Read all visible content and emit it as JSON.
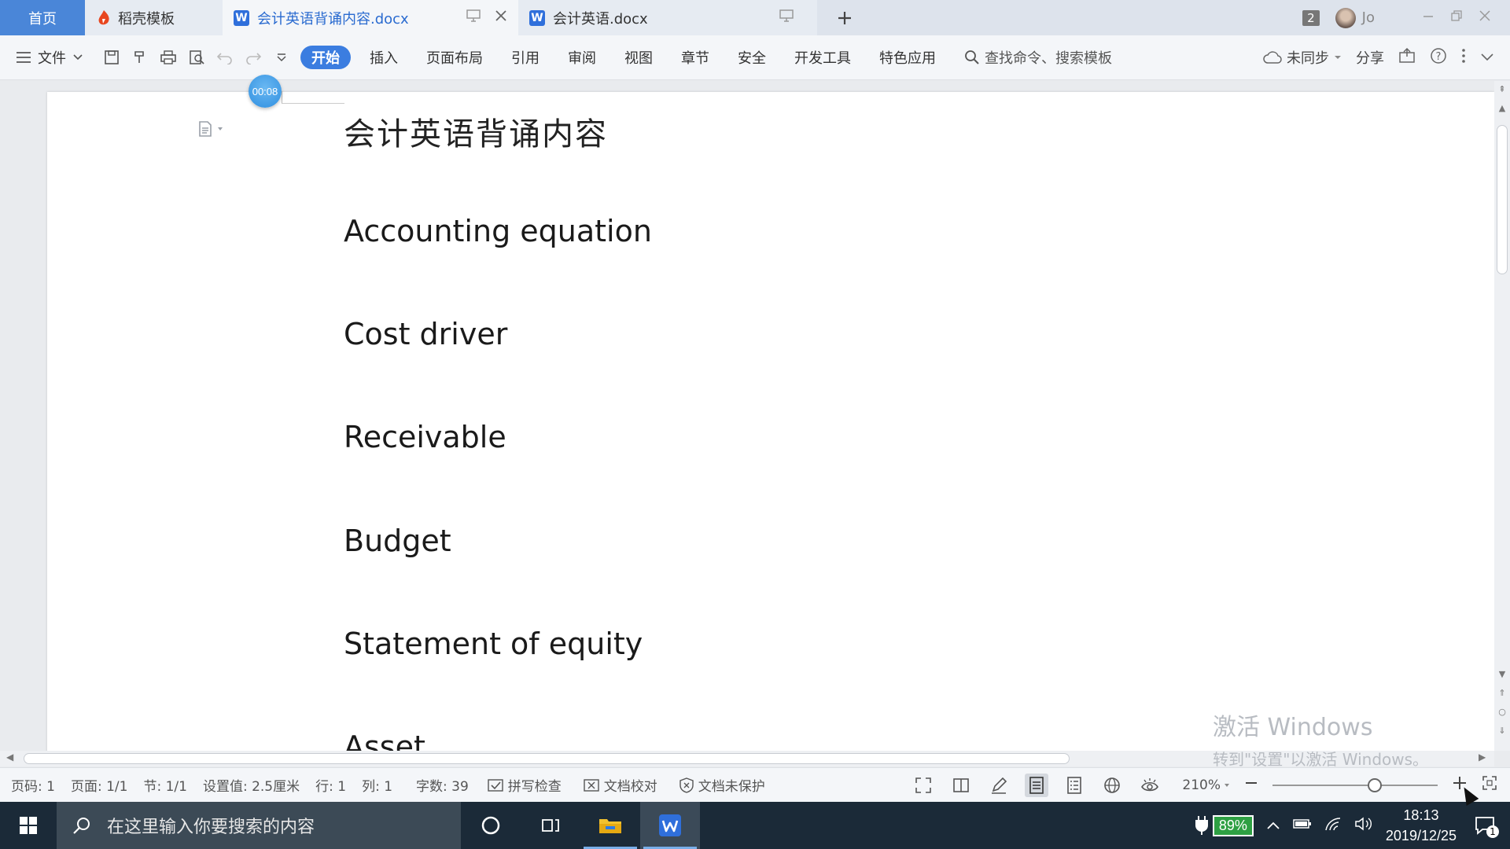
{
  "tabs": {
    "home": "首页",
    "docer": "稻壳模板",
    "active_doc": "会计英语背诵内容.docx",
    "second_doc": "会计英语.docx",
    "window_count": "2",
    "user": "Jo"
  },
  "toolbar": {
    "file_menu": "文件",
    "tabs": [
      {
        "label": "开始",
        "active": true
      },
      {
        "label": "插入"
      },
      {
        "label": "页面布局"
      },
      {
        "label": "引用"
      },
      {
        "label": "审阅"
      },
      {
        "label": "视图"
      },
      {
        "label": "章节"
      },
      {
        "label": "安全"
      },
      {
        "label": "开发工具"
      },
      {
        "label": "特色应用"
      }
    ],
    "search_placeholder": "查找命令、搜索模板",
    "sync": "未同步",
    "share": "分享"
  },
  "document": {
    "timer": "00:08",
    "title": "会计英语背诵内容",
    "terms": [
      "Accounting equation",
      "Cost driver",
      "Receivable",
      "Budget",
      "Statement of equity",
      "Asset"
    ]
  },
  "watermark": {
    "line1": "激活 Windows",
    "line2": "转到\"设置\"以激活 Windows。"
  },
  "statusbar": {
    "page_code": "页码: 1",
    "page": "页面: 1/1",
    "section": "节: 1/1",
    "setting": "设置值: 2.5厘米",
    "row": "行: 1",
    "col": "列: 1",
    "word_count": "字数: 39",
    "spell_check": "拼写检查",
    "doc_proof": "文档校对",
    "protect": "文档未保护",
    "zoom": "210%",
    "zoom_level_percent": 62
  },
  "taskbar": {
    "search_placeholder": "在这里输入你要搜索的内容",
    "battery": "89%",
    "time": "18:13",
    "date": "2019/12/25",
    "notifications": "1"
  },
  "colors": {
    "accent": "#3b7de0",
    "home_tab": "#4a86d8",
    "taskbar": "#1b2a38"
  }
}
